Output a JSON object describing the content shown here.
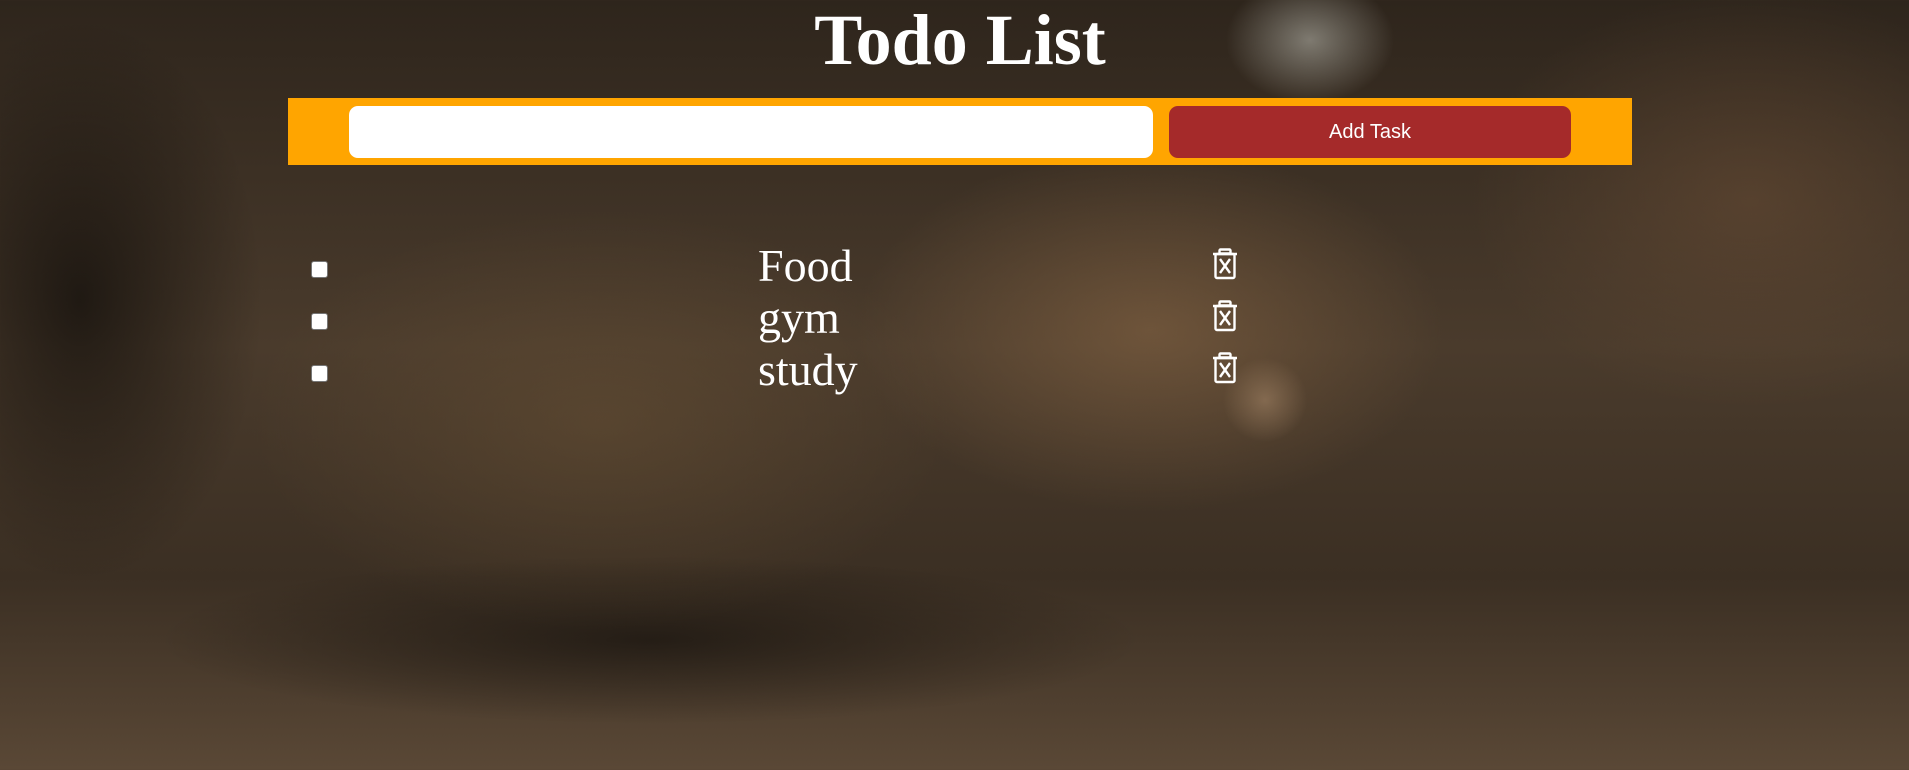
{
  "page": {
    "title": "Todo List"
  },
  "input_bar": {
    "input_value": "",
    "input_placeholder": "",
    "add_button_label": "Add Task",
    "bar_color": "#ffa500",
    "button_color": "#a52a2a"
  },
  "tasks": [
    {
      "label": "Food",
      "checked": false,
      "delete_icon": "trash-x-icon"
    },
    {
      "label": "gym",
      "checked": false,
      "delete_icon": "trash-x-icon"
    },
    {
      "label": "study",
      "checked": false,
      "delete_icon": "trash-x-icon"
    }
  ]
}
